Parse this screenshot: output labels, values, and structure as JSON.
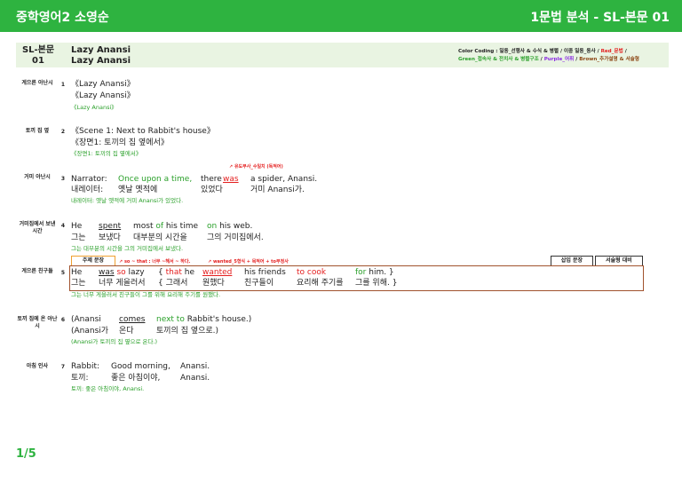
{
  "header": {
    "left_title": "중학영어2 소영순",
    "right_title": "1문법 분석 - SL-본문 01"
  },
  "info": {
    "code": "SL-본문\n01",
    "title": "Lazy Anansi\nLazy Anansi",
    "color_coding": {
      "prefix": "Color Coding : 일동_선행사 & 수식 & 병렬 / 이중 일동_동사 / ",
      "red": "Red_문법",
      "sep1": " /",
      "green": "Green_접속사 & 전치사 & 병렬구조",
      "sep2": " / ",
      "purple": "Purple_어휘",
      "sep3": " / ",
      "brown": "Brown_추가설명 & 서술형"
    }
  },
  "rows": [
    {
      "label": "게으른 아난시",
      "num": "1",
      "en": "《Lazy Anansi》",
      "ko": "《Lazy Anansi》",
      "tr": "《Lazy Anansi》"
    },
    {
      "label": "토끼 집 옆",
      "num": "2",
      "en": "《Scene 1: Next to Rabbit's house》",
      "ko": "《장면1: 토끼의 집 옆에서》",
      "tr": "《장면1: 토끼의 집 옆에서》"
    },
    {
      "label": "거미 아난시",
      "num": "3",
      "w": [
        "Narrator:",
        "Once upon a time,",
        "there",
        "was",
        "a spider, Anansi."
      ],
      "k": [
        "내레이터:",
        "옛날 옛적에",
        "있었다",
        "거미 Anansi가."
      ],
      "tr": "내레이터: 옛날 옛적에 거미 Anansi가 있었다.",
      "ann": "유도부사_수일치 (독적어)"
    },
    {
      "label": "거미집에서 보낸 시간",
      "num": "4",
      "w": [
        "He",
        "spent",
        "most ",
        "of",
        " his time",
        "on",
        " his web."
      ],
      "k": [
        "그는",
        "보냈다",
        "대부분의 시간을",
        "그의 거미집에서."
      ],
      "tr": "그는 대부분의 시간을 그의 거미집에서 보냈다."
    },
    {
      "label": "게으른 친구들",
      "num": "5",
      "w": [
        "He",
        "was",
        " so",
        " lazy",
        "{ ",
        "that",
        " he",
        "wanted",
        "his friends",
        "to cook",
        "for",
        " him. }"
      ],
      "k": [
        "그는",
        "너무 게을러서",
        "{ 그래서",
        "원했다",
        "친구들이",
        "요리해 주기를",
        "그를 위해. }"
      ],
      "tr": "그는 너무 게을러서 친구들이 그를 위해 요리해 주기를 원했다.",
      "tag_theme": "주제 문장",
      "ann1": "so ~ that : 너무 ~해서 ~ 하다.",
      "ann2": "wanted_5형식 + 목적어 + to부정사",
      "tag_insert": "삽입 문장",
      "tag_essay": "서술형 대비"
    },
    {
      "label": "토끼 집에 온 아난시",
      "num": "6",
      "w": [
        "(Anansi",
        "comes",
        "next to",
        " Rabbit's house.)"
      ],
      "k": [
        "(Anansi가",
        "온다",
        "토끼의 집 옆으로.)"
      ],
      "tr": "(Anansi가 토끼의 집 옆으로 온다.)"
    },
    {
      "label": "아침 인사",
      "num": "7",
      "w": [
        "Rabbit:",
        "Good morning,",
        "Anansi."
      ],
      "k": [
        "토끼:",
        "좋은 아침이야,",
        "Anansi."
      ],
      "tr": "토끼: 좋은 아침이야, Anansi."
    }
  ],
  "page_number": "1/5"
}
